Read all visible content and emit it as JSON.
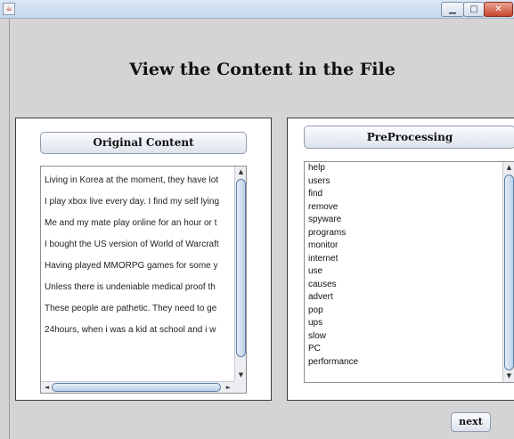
{
  "window": {
    "title": "",
    "icon": "java-coffee-icon",
    "controls": {
      "minimize": "▁",
      "maximize": "□",
      "close": "✕"
    }
  },
  "page": {
    "title": "View the Content in the File"
  },
  "original_panel": {
    "header_label": "Original Content",
    "lines": [
      "Living in Korea at the moment, they have lot",
      "I play xbox live every day. I find my self lying",
      "Me and my mate play online for an hour or t",
      "I bought the US version of World of Warcraft",
      "Having played MMORPG games for some y",
      "Unless there is undeniable medical proof th",
      "These people are pathetic. They need to ge",
      "24hours, when i was a kid at school and i w"
    ]
  },
  "preprocessing_panel": {
    "header_label": "PreProcessing",
    "words": [
      "help",
      "users",
      "find",
      "remove",
      "spyware",
      "programs",
      "monitor",
      "internet",
      "use",
      "causes",
      "advert",
      "pop",
      "ups",
      "slow",
      "PC",
      "performance"
    ]
  },
  "scroll_arrows": {
    "up": "▲",
    "down": "▼",
    "left": "◄",
    "right": "►"
  },
  "footer": {
    "next_label": "next"
  }
}
